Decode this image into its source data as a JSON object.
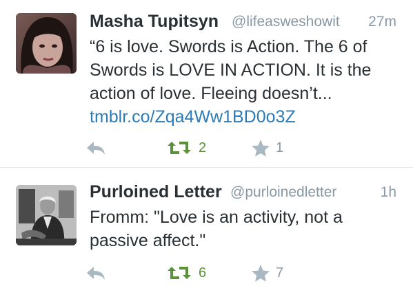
{
  "tweets": [
    {
      "display_name": "Masha Tupitsyn",
      "handle": "@lifeasweshowit",
      "time": "27m",
      "text_lines": [
        "“6 is love. Swords is Action. The 6 of",
        "Swords is LOVE IN ACTION. It is the",
        "action of love. Fleeing doesn’t..."
      ],
      "link": "tmblr.co/Zqa4Ww1BD0o3Z",
      "retweets": "2",
      "favorites": "1",
      "retweet_color": "#5c913b",
      "avatar_icon": "person-photo-avatar"
    },
    {
      "display_name": "Purloined Letter",
      "handle": "@purloinedletter",
      "time": "1h",
      "text_lines": [
        "Fromm: \"Love is an activity, not a",
        "passive affect.\""
      ],
      "retweets": "6",
      "favorites": "7",
      "retweet_color": "#5c913b",
      "avatar_icon": "bw-photo-avatar"
    }
  ],
  "icons": {
    "reply": "reply-icon",
    "retweet": "retweet-icon",
    "favorite": "star-icon"
  },
  "colors": {
    "link": "#2b7bb9",
    "meta": "#8899a6",
    "text": "#292f33"
  }
}
